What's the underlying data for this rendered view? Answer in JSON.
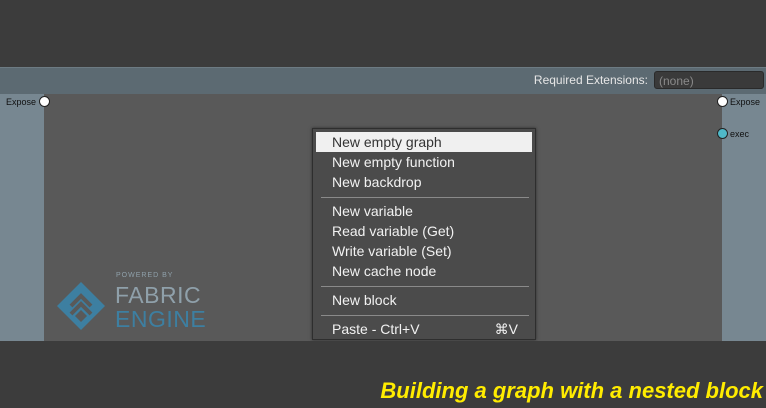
{
  "header": {
    "required_extensions_label": "Required Extensions:",
    "required_extensions_value": "(none)"
  },
  "graph": {
    "left_port_label": "Expose",
    "right_port_labels": [
      "Expose",
      "exec"
    ]
  },
  "logo": {
    "powered_by": "POWERED BY",
    "line1": "FABRIC",
    "line2": "ENGINE"
  },
  "context_menu": {
    "items": [
      {
        "label": "New empty graph",
        "selected": true
      },
      {
        "label": "New empty function"
      },
      {
        "label": "New backdrop"
      },
      {
        "label": "New variable"
      },
      {
        "label": "Read variable (Get)"
      },
      {
        "label": "Write variable (Set)"
      },
      {
        "label": "New cache node"
      },
      {
        "label": "New block"
      },
      {
        "label": "Paste - Ctrl+V",
        "shortcut": "⌘V"
      }
    ]
  },
  "caption": "Building a graph with a nested block",
  "colors": {
    "canvas": "#595959",
    "side_panel": "#778791",
    "header": "#5c6a72",
    "caption": "#ffec00",
    "exec_port": "#4fb8c8"
  }
}
